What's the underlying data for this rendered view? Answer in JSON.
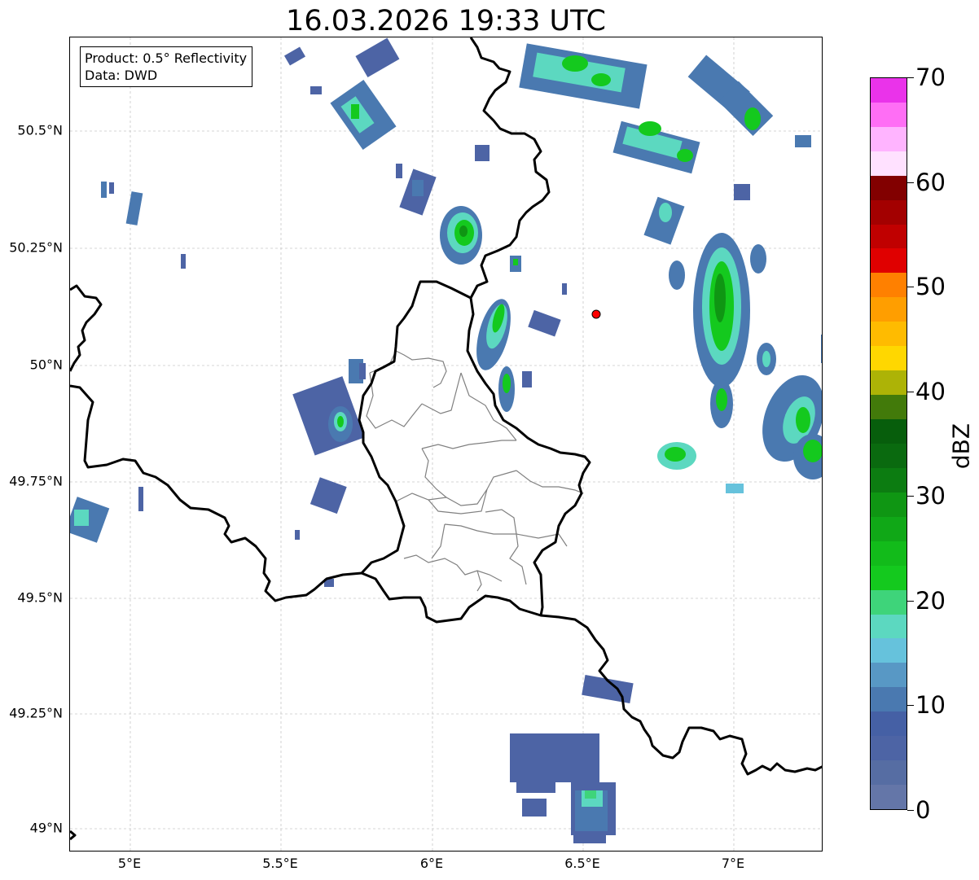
{
  "title": "16.03.2026 19:33 UTC",
  "info": {
    "product": "Product: 0.5° Reflectivity",
    "data": "Data: DWD"
  },
  "lat_labels": [
    "50.5°N",
    "50.25°N",
    "50°N",
    "49.75°N",
    "49.5°N",
    "49.25°N",
    "49°N"
  ],
  "lon_labels": [
    "5°E",
    "5.5°E",
    "6°E",
    "6.5°E",
    "7°E"
  ],
  "colorbar": {
    "label": "dBZ",
    "tick_labels": [
      "0",
      "10",
      "20",
      "30",
      "40",
      "50",
      "60",
      "70"
    ],
    "colors": [
      "#6476a8",
      "#566da3",
      "#4d64a5",
      "#4560a5",
      "#4a79b0",
      "#5898c5",
      "#66c2dc",
      "#5cd8c0",
      "#3ed47a",
      "#14c91e",
      "#12bb1a",
      "#10a817",
      "#0f9613",
      "#0c7c11",
      "#0a6a0f",
      "#075e0c",
      "#427a0a",
      "#adb306",
      "#ffd700",
      "#ffbb00",
      "#ff9e00",
      "#ff8000",
      "#e00000",
      "#c00000",
      "#a30000",
      "#820000",
      "#ffe1ff",
      "#ffb4ff",
      "#ff6ef5",
      "#ea33ea"
    ]
  },
  "marker": {
    "name": "radar-site",
    "color": "#ff0000"
  },
  "colors": {
    "border": "#000000",
    "admin_border": "#808080",
    "grid": "#c8c8c8"
  }
}
